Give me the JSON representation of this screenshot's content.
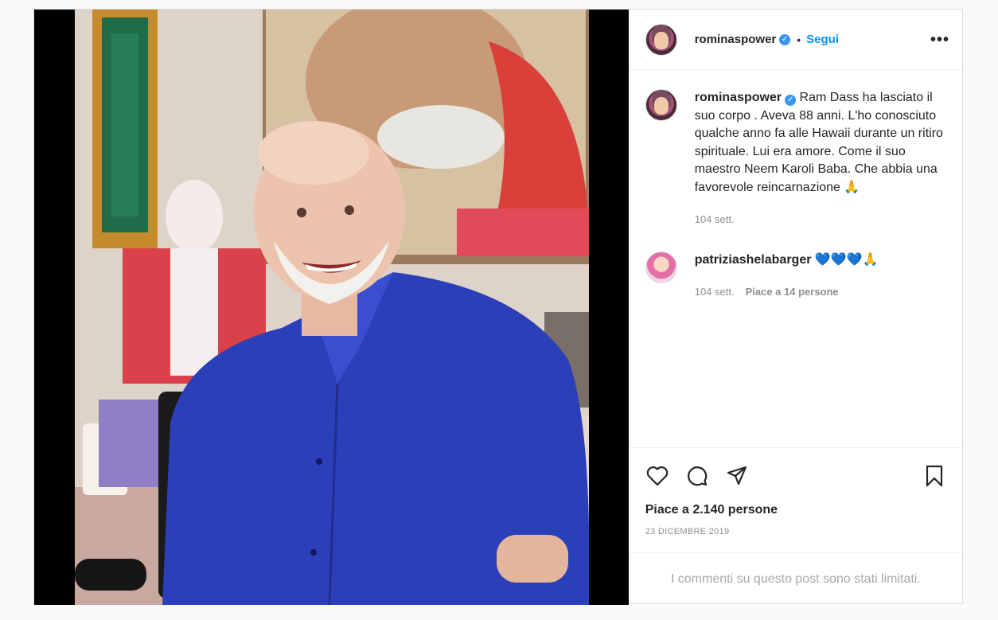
{
  "post": {
    "author": "rominaspower",
    "verified_mark": "✓",
    "separator": "•",
    "follow_label": "Segui",
    "more_label": "•••",
    "caption_text": "Ram Dass ha lasciato il suo corpo . Aveva 88 anni. L'ho conosciuto qualche anno fa alle Hawaii durante un ritiro spirituale. Lui era amore. Come il suo maestro Neem Karoli Baba. Che abbia una favorevole reincarnazione 🙏",
    "caption_time": "104 sett.",
    "likes": "Piace a 2.140 persone",
    "date": "23 DICEMBRE 2019",
    "comments_limited": "I commenti su questo post sono stati limitati."
  },
  "comments": [
    {
      "user": "patriziashelabarger",
      "text": "💙💙💙🙏",
      "time": "104 sett.",
      "likes": "Piace a 14 persone"
    }
  ],
  "icons": {
    "like": "heart-icon",
    "comment": "comment-icon",
    "share": "share-icon",
    "save": "bookmark-icon",
    "verified": "verified-badge-icon"
  },
  "colors": {
    "accent": "#0095f6",
    "verified": "#3897f0",
    "muted": "#8e8e8e",
    "shirt": "#2b3fb8"
  }
}
